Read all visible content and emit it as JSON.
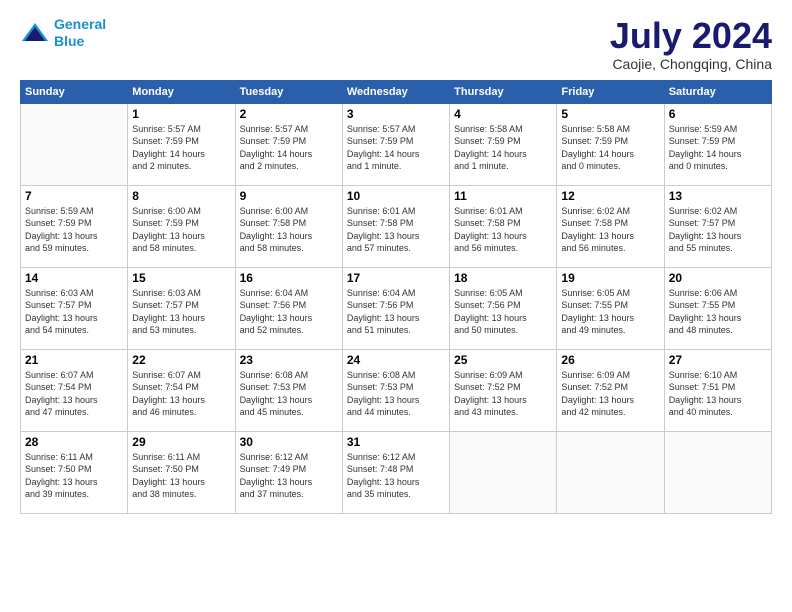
{
  "logo": {
    "line1": "General",
    "line2": "Blue"
  },
  "title": "July 2024",
  "location": "Caojie, Chongqing, China",
  "days_of_week": [
    "Sunday",
    "Monday",
    "Tuesday",
    "Wednesday",
    "Thursday",
    "Friday",
    "Saturday"
  ],
  "weeks": [
    [
      {
        "day": "",
        "info": ""
      },
      {
        "day": "1",
        "info": "Sunrise: 5:57 AM\nSunset: 7:59 PM\nDaylight: 14 hours\nand 2 minutes."
      },
      {
        "day": "2",
        "info": "Sunrise: 5:57 AM\nSunset: 7:59 PM\nDaylight: 14 hours\nand 2 minutes."
      },
      {
        "day": "3",
        "info": "Sunrise: 5:57 AM\nSunset: 7:59 PM\nDaylight: 14 hours\nand 1 minute."
      },
      {
        "day": "4",
        "info": "Sunrise: 5:58 AM\nSunset: 7:59 PM\nDaylight: 14 hours\nand 1 minute."
      },
      {
        "day": "5",
        "info": "Sunrise: 5:58 AM\nSunset: 7:59 PM\nDaylight: 14 hours\nand 0 minutes."
      },
      {
        "day": "6",
        "info": "Sunrise: 5:59 AM\nSunset: 7:59 PM\nDaylight: 14 hours\nand 0 minutes."
      }
    ],
    [
      {
        "day": "7",
        "info": "Sunrise: 5:59 AM\nSunset: 7:59 PM\nDaylight: 13 hours\nand 59 minutes."
      },
      {
        "day": "8",
        "info": "Sunrise: 6:00 AM\nSunset: 7:59 PM\nDaylight: 13 hours\nand 58 minutes."
      },
      {
        "day": "9",
        "info": "Sunrise: 6:00 AM\nSunset: 7:58 PM\nDaylight: 13 hours\nand 58 minutes."
      },
      {
        "day": "10",
        "info": "Sunrise: 6:01 AM\nSunset: 7:58 PM\nDaylight: 13 hours\nand 57 minutes."
      },
      {
        "day": "11",
        "info": "Sunrise: 6:01 AM\nSunset: 7:58 PM\nDaylight: 13 hours\nand 56 minutes."
      },
      {
        "day": "12",
        "info": "Sunrise: 6:02 AM\nSunset: 7:58 PM\nDaylight: 13 hours\nand 56 minutes."
      },
      {
        "day": "13",
        "info": "Sunrise: 6:02 AM\nSunset: 7:57 PM\nDaylight: 13 hours\nand 55 minutes."
      }
    ],
    [
      {
        "day": "14",
        "info": "Sunrise: 6:03 AM\nSunset: 7:57 PM\nDaylight: 13 hours\nand 54 minutes."
      },
      {
        "day": "15",
        "info": "Sunrise: 6:03 AM\nSunset: 7:57 PM\nDaylight: 13 hours\nand 53 minutes."
      },
      {
        "day": "16",
        "info": "Sunrise: 6:04 AM\nSunset: 7:56 PM\nDaylight: 13 hours\nand 52 minutes."
      },
      {
        "day": "17",
        "info": "Sunrise: 6:04 AM\nSunset: 7:56 PM\nDaylight: 13 hours\nand 51 minutes."
      },
      {
        "day": "18",
        "info": "Sunrise: 6:05 AM\nSunset: 7:56 PM\nDaylight: 13 hours\nand 50 minutes."
      },
      {
        "day": "19",
        "info": "Sunrise: 6:05 AM\nSunset: 7:55 PM\nDaylight: 13 hours\nand 49 minutes."
      },
      {
        "day": "20",
        "info": "Sunrise: 6:06 AM\nSunset: 7:55 PM\nDaylight: 13 hours\nand 48 minutes."
      }
    ],
    [
      {
        "day": "21",
        "info": "Sunrise: 6:07 AM\nSunset: 7:54 PM\nDaylight: 13 hours\nand 47 minutes."
      },
      {
        "day": "22",
        "info": "Sunrise: 6:07 AM\nSunset: 7:54 PM\nDaylight: 13 hours\nand 46 minutes."
      },
      {
        "day": "23",
        "info": "Sunrise: 6:08 AM\nSunset: 7:53 PM\nDaylight: 13 hours\nand 45 minutes."
      },
      {
        "day": "24",
        "info": "Sunrise: 6:08 AM\nSunset: 7:53 PM\nDaylight: 13 hours\nand 44 minutes."
      },
      {
        "day": "25",
        "info": "Sunrise: 6:09 AM\nSunset: 7:52 PM\nDaylight: 13 hours\nand 43 minutes."
      },
      {
        "day": "26",
        "info": "Sunrise: 6:09 AM\nSunset: 7:52 PM\nDaylight: 13 hours\nand 42 minutes."
      },
      {
        "day": "27",
        "info": "Sunrise: 6:10 AM\nSunset: 7:51 PM\nDaylight: 13 hours\nand 40 minutes."
      }
    ],
    [
      {
        "day": "28",
        "info": "Sunrise: 6:11 AM\nSunset: 7:50 PM\nDaylight: 13 hours\nand 39 minutes."
      },
      {
        "day": "29",
        "info": "Sunrise: 6:11 AM\nSunset: 7:50 PM\nDaylight: 13 hours\nand 38 minutes."
      },
      {
        "day": "30",
        "info": "Sunrise: 6:12 AM\nSunset: 7:49 PM\nDaylight: 13 hours\nand 37 minutes."
      },
      {
        "day": "31",
        "info": "Sunrise: 6:12 AM\nSunset: 7:48 PM\nDaylight: 13 hours\nand 35 minutes."
      },
      {
        "day": "",
        "info": ""
      },
      {
        "day": "",
        "info": ""
      },
      {
        "day": "",
        "info": ""
      }
    ]
  ]
}
